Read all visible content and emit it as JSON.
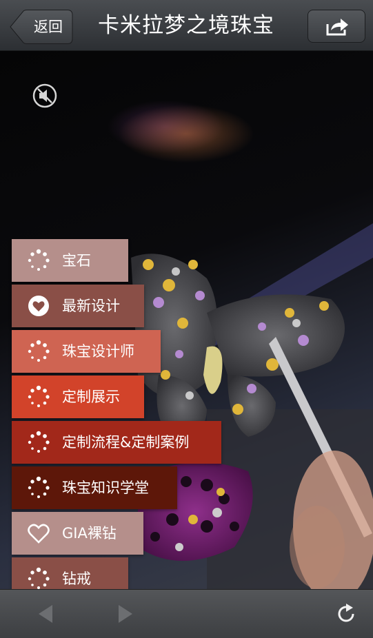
{
  "navbar": {
    "back_label": "返回",
    "title": "卡米拉梦之境珠宝",
    "share_icon": "share-icon"
  },
  "audio": {
    "icon": "speaker-muted-icon"
  },
  "menu": [
    {
      "label": "宝石",
      "icon": "loading-dots-icon",
      "color": "#b58f8b"
    },
    {
      "label": "最新设计",
      "icon": "heart-icon",
      "color": "#8a4f47"
    },
    {
      "label": "珠宝设计师",
      "icon": "loading-dots-icon",
      "color": "#cf6452"
    },
    {
      "label": "定制展示",
      "icon": "loading-dots-icon",
      "color": "#d2432a"
    },
    {
      "label": "定制流程&定制案例",
      "icon": "loading-dots-icon",
      "color": "#a2281a"
    },
    {
      "label": "珠宝知识学堂",
      "icon": "loading-dots-icon",
      "color": "#5d1709"
    },
    {
      "label": "GIA裸钻",
      "icon": "heart-outline-icon",
      "color": "#b58f8b"
    },
    {
      "label": "钻戒",
      "icon": "loading-dots-icon",
      "color": "#8a4f47"
    }
  ],
  "toolbar": {
    "back_icon": "arrow-left-icon",
    "forward_icon": "arrow-right-icon",
    "reload_icon": "reload-icon"
  }
}
